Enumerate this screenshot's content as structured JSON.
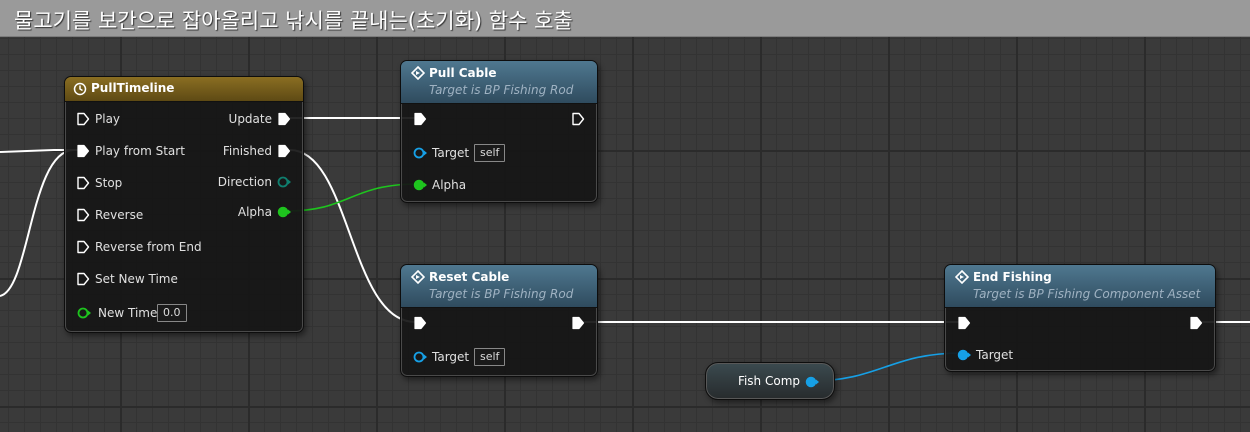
{
  "comment": {
    "title": "물고기를 보간으로 잡아올리고 낚시를 끝내는(초기화) 함수 호출"
  },
  "timeline_node": {
    "title": "PullTimeline",
    "inputs": [
      "Play",
      "Play from Start",
      "Stop",
      "Reverse",
      "Reverse from End",
      "Set New Time"
    ],
    "new_time_label": "New Time",
    "new_time_value": "0.0",
    "outputs": {
      "update": "Update",
      "finished": "Finished",
      "direction": "Direction",
      "alpha": "Alpha"
    }
  },
  "pull_cable": {
    "title": "Pull Cable",
    "subtitle": "Target is BP Fishing Rod",
    "target_label": "Target",
    "target_value": "self",
    "alpha_label": "Alpha"
  },
  "reset_cable": {
    "title": "Reset Cable",
    "subtitle": "Target is BP Fishing Rod",
    "target_label": "Target",
    "target_value": "self"
  },
  "end_fishing": {
    "title": "End Fishing",
    "subtitle": "Target is BP Fishing Component Asset",
    "target_label": "Target"
  },
  "fish_comp": {
    "label": "Fish Comp"
  },
  "colors": {
    "exec": "#ffffff",
    "float_pin": "#1ec41e",
    "object_pin": "#16a0e6",
    "enum_pin": "#0f7f6f",
    "comment_bar": "#9a9a9a",
    "timeline_header": "#8a6e22",
    "function_header": "#4f7890"
  }
}
